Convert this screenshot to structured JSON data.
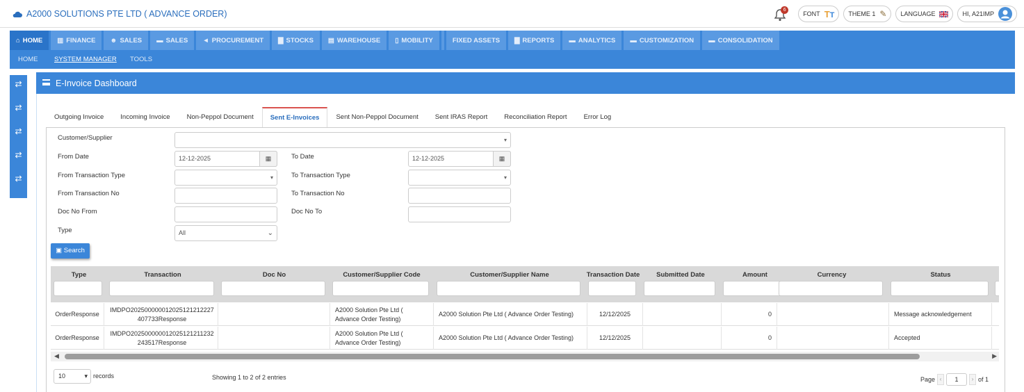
{
  "app": {
    "title": "A2000 SOLUTIONS PTE LTD ( ADVANCE ORDER)"
  },
  "header": {
    "notification_count": "6",
    "font_label": "FONT",
    "theme_label": "THEME 1",
    "language_label": "LANGUAGE",
    "user_label": "HI, A21IMP"
  },
  "menu": [
    {
      "label": "HOME",
      "icon": "home-icon"
    },
    {
      "label": "FINANCE",
      "icon": "bank-icon"
    },
    {
      "label": "SALES",
      "icon": "users-icon"
    },
    {
      "label": "SALES",
      "icon": "cart-icon"
    },
    {
      "label": "PROCUREMENT",
      "icon": "bullhorn-icon"
    },
    {
      "label": "STOCKS",
      "icon": "bar-chart-icon"
    },
    {
      "label": "WAREHOUSE",
      "icon": "warehouse-icon"
    },
    {
      "label": "MOBILITY",
      "icon": "mobile-icon"
    },
    {
      "label": "",
      "icon": ""
    },
    {
      "label": "FIXED ASSETS",
      "icon": ""
    },
    {
      "label": "REPORTS",
      "icon": "bar-chart-icon"
    },
    {
      "label": "ANALYTICS",
      "icon": "cart-icon"
    },
    {
      "label": "CUSTOMIZATION",
      "icon": "cart-icon"
    },
    {
      "label": "CONSOLIDATION",
      "icon": "cart-icon"
    }
  ],
  "submenu": [
    "HOME",
    "SYSTEM MANAGER",
    "TOOLS"
  ],
  "page": {
    "title": "E-Invoice Dashboard"
  },
  "tabs": [
    "Outgoing Invoice",
    "Incoming Invoice",
    "Non-Peppol Document",
    "Sent E-Invoices",
    "Sent Non-Peppol Document",
    "Sent IRAS Report",
    "Reconciliation Report",
    "Error Log"
  ],
  "active_tab": "Sent E-Invoices",
  "filters": {
    "customer_supplier_label": "Customer/Supplier",
    "customer_supplier_value": "",
    "from_date_label": "From Date",
    "from_date_value": "12-12-2025",
    "to_date_label": "To Date",
    "to_date_value": "12-12-2025",
    "from_txn_type_label": "From Transaction Type",
    "to_txn_type_label": "To Transaction Type",
    "from_txn_no_label": "From Transaction No",
    "to_txn_no_label": "To Transaction No",
    "doc_no_from_label": "Doc No From",
    "doc_no_to_label": "Doc No To",
    "type_label": "Type",
    "type_value": "All",
    "search_label": "Search"
  },
  "table": {
    "columns": [
      "Type",
      "Transaction",
      "Doc No",
      "Customer/Supplier Code",
      "Customer/Supplier Name",
      "Transaction Date",
      "Submitted Date",
      "Amount",
      "Currency",
      "Status"
    ],
    "rows": [
      {
        "type": "OrderResponse",
        "transaction": "IMDPO2025000000120251212122740773 3Response",
        "transaction_l1": "IMDPO202500000012025121212227",
        "transaction_l2": "407733Response",
        "doc_no": "",
        "code_l1": "A2000 Solution Pte Ltd (",
        "code_l2": "Advance Order Testing)",
        "name": "A2000 Solution Pte Ltd ( Advance Order Testing)",
        "txn_date": "12/12/2025",
        "submitted_date": "",
        "amount": "0",
        "currency": "",
        "status": "Message acknowledgement"
      },
      {
        "type": "OrderResponse",
        "transaction": "IMDPO20250000001202512121232243517Response",
        "transaction_l1": "IMDPO202500000012025121211232",
        "transaction_l2": "243517Response",
        "doc_no": "",
        "code_l1": "A2000 Solution Pte Ltd (",
        "code_l2": "Advance Order Testing)",
        "name": "A2000 Solution Pte Ltd ( Advance Order Testing)",
        "txn_date": "12/12/2025",
        "submitted_date": "",
        "amount": "0",
        "currency": "",
        "status": "Accepted"
      }
    ]
  },
  "footer": {
    "page_size": "10",
    "records_label": "records",
    "showing": "Showing 1 to 2 of 2 entries",
    "page_label": "Page",
    "page_value": "1",
    "of_label": "of 1"
  },
  "colors": {
    "primary": "#3b86d9",
    "brand_text": "#2a6ebd",
    "active_tab_border": "#d9534f"
  }
}
